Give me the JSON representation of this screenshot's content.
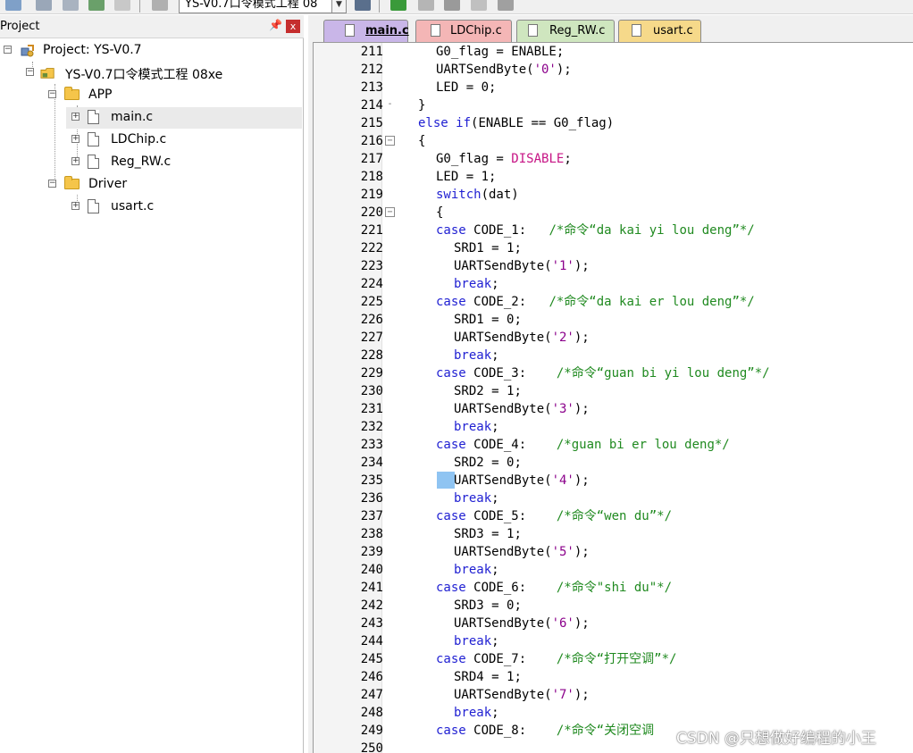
{
  "toolbar": {
    "project_combo_value": "YS-V0.7口令模式工程 08",
    "accent_colors": {
      "build_green": "#3a9a3a",
      "gray": "#8a8a8a"
    }
  },
  "project_panel": {
    "title": "Project",
    "pin_glyph": "ᵖ",
    "close_glyph": "x",
    "tree": [
      {
        "label": "Project: YS-V0.7",
        "icon": "project-icon",
        "level": 0
      },
      {
        "label": "YS-V0.7口令模式工程 08xe",
        "icon": "target-folder-icon",
        "level": 1
      },
      {
        "label": "APP",
        "icon": "folder-icon",
        "level": 2
      },
      {
        "label": "main.c",
        "icon": "file-icon",
        "level": 3,
        "selected": true
      },
      {
        "label": "LDChip.c",
        "icon": "file-icon",
        "level": 3
      },
      {
        "label": "Reg_RW.c",
        "icon": "file-icon",
        "level": 3
      },
      {
        "label": "Driver",
        "icon": "folder-icon",
        "level": 2
      },
      {
        "label": "usart.c",
        "icon": "file-icon",
        "level": 3
      }
    ]
  },
  "editor": {
    "tabs": [
      {
        "label": "main.c",
        "color": "#c9b6e8",
        "active": true
      },
      {
        "label": "LDChip.c",
        "color": "#f4b6b6",
        "active": false
      },
      {
        "label": "Reg_RW.c",
        "color": "#cfe6bf",
        "active": false
      },
      {
        "label": "usart.c",
        "color": "#f6d98a",
        "active": false
      }
    ],
    "lines": [
      {
        "no": "211",
        "fold": "",
        "indent": 1,
        "tokens": [
          [
            "G0_flag = ENABLE;",
            ""
          ]
        ]
      },
      {
        "no": "212",
        "fold": "",
        "indent": 1,
        "tokens": [
          [
            "UARTSendByte(",
            ""
          ],
          [
            "'0'",
            "str"
          ],
          [
            ");",
            ""
          ]
        ]
      },
      {
        "no": "213",
        "fold": "",
        "indent": 1,
        "tokens": [
          [
            "LED = ",
            ""
          ],
          [
            "0",
            "num"
          ],
          [
            ";",
            ""
          ]
        ]
      },
      {
        "no": "214",
        "fold": "end",
        "indent": 0,
        "tokens": [
          [
            "}",
            ""
          ]
        ]
      },
      {
        "no": "215",
        "fold": "",
        "indent": 0,
        "tokens": [
          [
            "else",
            "kw"
          ],
          [
            " ",
            ""
          ],
          [
            "if",
            "kw"
          ],
          [
            "(ENABLE == G0_flag)",
            ""
          ]
        ]
      },
      {
        "no": "216",
        "fold": "box",
        "indent": 0,
        "tokens": [
          [
            "{",
            ""
          ]
        ]
      },
      {
        "no": "217",
        "fold": "",
        "indent": 1,
        "tokens": [
          [
            "G0_flag = ",
            ""
          ],
          [
            "DISABLE",
            "mac"
          ],
          [
            ";",
            ""
          ]
        ]
      },
      {
        "no": "218",
        "fold": "",
        "indent": 1,
        "tokens": [
          [
            "LED = ",
            ""
          ],
          [
            "1",
            "num"
          ],
          [
            ";",
            ""
          ]
        ]
      },
      {
        "no": "219",
        "fold": "",
        "indent": 1,
        "tokens": [
          [
            "switch",
            "kw"
          ],
          [
            "(dat)",
            ""
          ]
        ]
      },
      {
        "no": "220",
        "fold": "box",
        "indent": 1,
        "tokens": [
          [
            "{",
            ""
          ]
        ]
      },
      {
        "no": "221",
        "fold": "",
        "indent": 1,
        "tokens": [
          [
            "case",
            "kw"
          ],
          [
            " CODE_1:   ",
            ""
          ],
          [
            "/*命令“da kai yi lou deng”*/",
            "cm"
          ]
        ]
      },
      {
        "no": "222",
        "fold": "",
        "indent": 2,
        "tokens": [
          [
            "SRD1 = ",
            ""
          ],
          [
            "1",
            "num"
          ],
          [
            ";",
            ""
          ]
        ]
      },
      {
        "no": "223",
        "fold": "",
        "indent": 2,
        "tokens": [
          [
            "UARTSendByte(",
            ""
          ],
          [
            "'1'",
            "str"
          ],
          [
            ");",
            ""
          ]
        ]
      },
      {
        "no": "224",
        "fold": "",
        "indent": 2,
        "tokens": [
          [
            "break",
            "kw"
          ],
          [
            ";",
            ""
          ]
        ]
      },
      {
        "no": "225",
        "fold": "",
        "indent": 1,
        "tokens": [
          [
            "case",
            "kw"
          ],
          [
            " CODE_2:   ",
            ""
          ],
          [
            "/*命令“da kai er lou deng”*/",
            "cm"
          ]
        ]
      },
      {
        "no": "226",
        "fold": "",
        "indent": 2,
        "tokens": [
          [
            "SRD1 = ",
            ""
          ],
          [
            "0",
            "num"
          ],
          [
            ";",
            ""
          ]
        ]
      },
      {
        "no": "227",
        "fold": "",
        "indent": 2,
        "tokens": [
          [
            "UARTSendByte(",
            ""
          ],
          [
            "'2'",
            "str"
          ],
          [
            ");",
            ""
          ]
        ]
      },
      {
        "no": "228",
        "fold": "",
        "indent": 2,
        "tokens": [
          [
            "break",
            "kw"
          ],
          [
            ";",
            ""
          ]
        ]
      },
      {
        "no": "229",
        "fold": "",
        "indent": 1,
        "tokens": [
          [
            "case",
            "kw"
          ],
          [
            " CODE_3:    ",
            ""
          ],
          [
            "/*命令“guan bi yi lou deng”*/",
            "cm"
          ]
        ]
      },
      {
        "no": "230",
        "fold": "",
        "indent": 2,
        "tokens": [
          [
            "SRD2 = ",
            ""
          ],
          [
            "1",
            "num"
          ],
          [
            ";",
            ""
          ]
        ]
      },
      {
        "no": "231",
        "fold": "",
        "indent": 2,
        "tokens": [
          [
            "UARTSendByte(",
            ""
          ],
          [
            "'3'",
            "str"
          ],
          [
            ");",
            ""
          ]
        ]
      },
      {
        "no": "232",
        "fold": "",
        "indent": 2,
        "tokens": [
          [
            "break",
            "kw"
          ],
          [
            ";",
            ""
          ]
        ]
      },
      {
        "no": "233",
        "fold": "",
        "indent": 1,
        "tokens": [
          [
            "case",
            "kw"
          ],
          [
            " CODE_4:    ",
            ""
          ],
          [
            "/*guan bi er lou deng*/",
            "cm"
          ]
        ]
      },
      {
        "no": "234",
        "fold": "",
        "indent": 2,
        "tokens": [
          [
            "SRD2 = ",
            ""
          ],
          [
            "0",
            "num"
          ],
          [
            ";",
            ""
          ]
        ]
      },
      {
        "no": "235",
        "fold": "",
        "indent": 2,
        "tokens": [
          [
            "UARTSendByte(",
            ""
          ],
          [
            "'4'",
            "str"
          ],
          [
            ");",
            ""
          ]
        ]
      },
      {
        "no": "236",
        "fold": "",
        "indent": 2,
        "tokens": [
          [
            "break",
            "kw"
          ],
          [
            ";",
            ""
          ]
        ]
      },
      {
        "no": "237",
        "fold": "",
        "indent": 1,
        "tokens": [
          [
            "case",
            "kw"
          ],
          [
            " CODE_5:    ",
            ""
          ],
          [
            "/*命令“wen du”*/",
            "cm"
          ]
        ]
      },
      {
        "no": "238",
        "fold": "",
        "indent": 2,
        "tokens": [
          [
            "SRD3 = ",
            ""
          ],
          [
            "1",
            "num"
          ],
          [
            ";",
            ""
          ]
        ]
      },
      {
        "no": "239",
        "fold": "",
        "indent": 2,
        "tokens": [
          [
            "UARTSendByte(",
            ""
          ],
          [
            "'5'",
            "str"
          ],
          [
            ");",
            ""
          ]
        ]
      },
      {
        "no": "240",
        "fold": "",
        "indent": 2,
        "tokens": [
          [
            "break",
            "kw"
          ],
          [
            ";",
            ""
          ]
        ]
      },
      {
        "no": "241",
        "fold": "",
        "indent": 1,
        "tokens": [
          [
            "case",
            "kw"
          ],
          [
            " CODE_6:    ",
            ""
          ],
          [
            "/*命令\"shi du\"*/",
            "cm"
          ]
        ]
      },
      {
        "no": "242",
        "fold": "",
        "indent": 2,
        "tokens": [
          [
            "SRD3 = ",
            ""
          ],
          [
            "0",
            "num"
          ],
          [
            ";",
            ""
          ]
        ]
      },
      {
        "no": "243",
        "fold": "",
        "indent": 2,
        "tokens": [
          [
            "UARTSendByte(",
            ""
          ],
          [
            "'6'",
            "str"
          ],
          [
            ");",
            ""
          ]
        ]
      },
      {
        "no": "244",
        "fold": "",
        "indent": 2,
        "tokens": [
          [
            "break",
            "kw"
          ],
          [
            ";",
            ""
          ]
        ]
      },
      {
        "no": "245",
        "fold": "",
        "indent": 1,
        "tokens": [
          [
            "case",
            "kw"
          ],
          [
            " CODE_7:    ",
            ""
          ],
          [
            "/*命令“打开空调”*/",
            "cm"
          ]
        ]
      },
      {
        "no": "246",
        "fold": "",
        "indent": 2,
        "tokens": [
          [
            "SRD4 = ",
            ""
          ],
          [
            "1",
            "num"
          ],
          [
            ";",
            ""
          ]
        ]
      },
      {
        "no": "247",
        "fold": "",
        "indent": 2,
        "tokens": [
          [
            "UARTSendByte(",
            ""
          ],
          [
            "'7'",
            "str"
          ],
          [
            ");",
            ""
          ]
        ]
      },
      {
        "no": "248",
        "fold": "",
        "indent": 2,
        "tokens": [
          [
            "break",
            "kw"
          ],
          [
            ";",
            ""
          ]
        ]
      },
      {
        "no": "249",
        "fold": "",
        "indent": 1,
        "tokens": [
          [
            "case",
            "kw"
          ],
          [
            " CODE_8:    ",
            ""
          ],
          [
            "/*命令“关闭空调",
            "cm"
          ]
        ]
      },
      {
        "no": "250",
        "fold": "",
        "indent": 1,
        "tokens": []
      }
    ]
  },
  "watermark": "CSDN @只想做好编程的小王"
}
